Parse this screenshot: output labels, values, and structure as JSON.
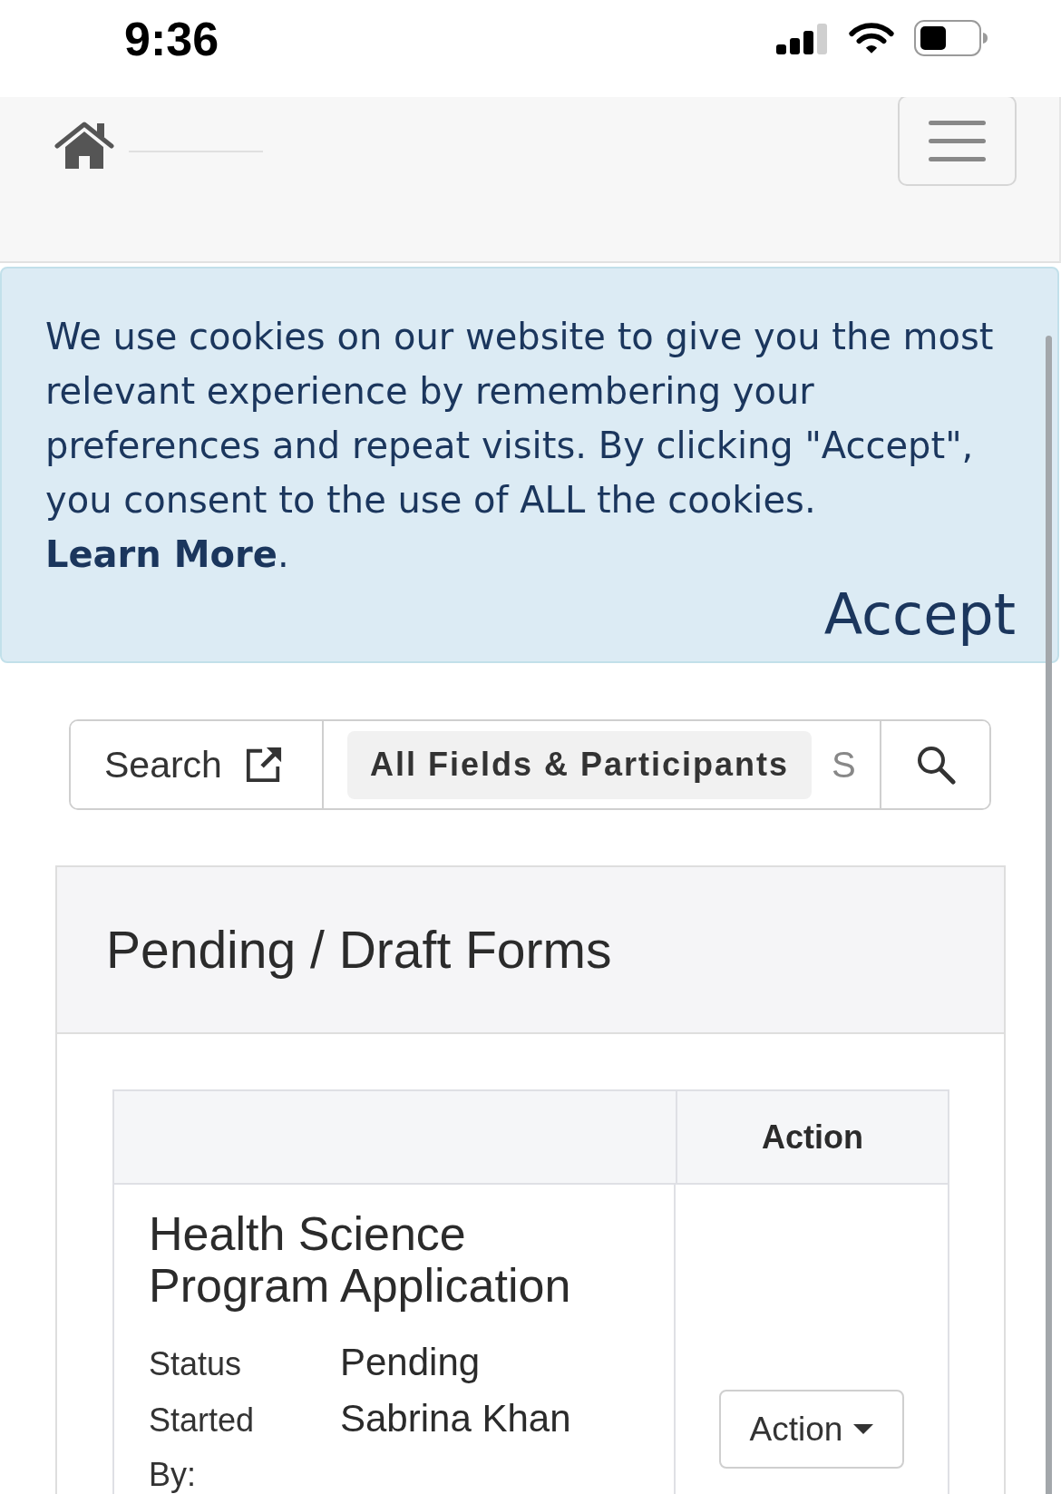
{
  "status_bar": {
    "time": "9:36"
  },
  "cookie_banner": {
    "message": "We use cookies on our website to give you the most relevant experience by remembering your preferences and repeat visits. By clicking \"Accept\", you consent to the use of ALL the cookies.",
    "link": "Learn More",
    "link_end": ".",
    "accept_button": "Accept"
  },
  "search_bar": {
    "scope_button": "Search",
    "filter_button": "All Fields & Participants",
    "input": {
      "placeholder": "S"
    }
  },
  "panel": {
    "title": "Pending / Draft Forms",
    "table": {
      "header": {
        "column_2": "Action"
      },
      "rows": [
        {
          "title": "Health Science Program Application",
          "fields": [
            {
              "label": "Status",
              "value": "Pending"
            },
            {
              "label": "Started By:",
              "value": "Sabrina Khan"
            }
          ],
          "action_button": "Action"
        }
      ]
    }
  }
}
